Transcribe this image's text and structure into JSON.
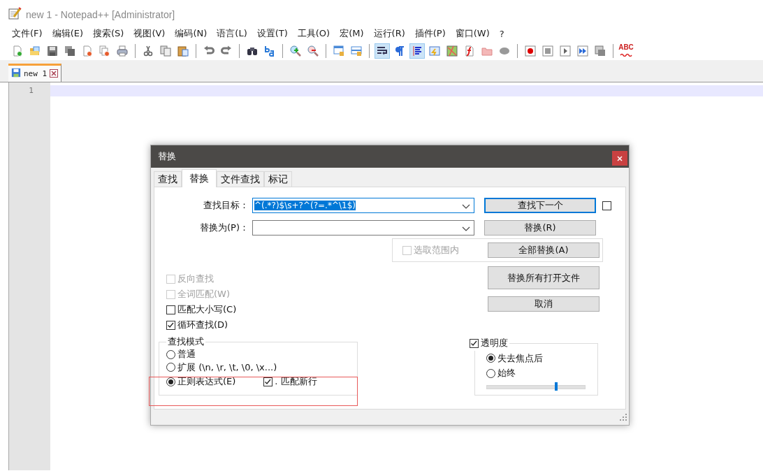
{
  "window": {
    "title": "new 1 - Notepad++ [Administrator]"
  },
  "menu": [
    "文件(F)",
    "编辑(E)",
    "搜索(S)",
    "视图(V)",
    "编码(N)",
    "语言(L)",
    "设置(T)",
    "工具(O)",
    "宏(M)",
    "运行(R)",
    "插件(P)",
    "窗口(W)",
    "?"
  ],
  "toolbar": [
    {
      "kind": "new",
      "on": false
    },
    {
      "kind": "open",
      "on": false
    },
    {
      "kind": "save",
      "on": false
    },
    {
      "kind": "saveall",
      "on": false
    },
    {
      "kind": "close",
      "on": false
    },
    {
      "kind": "closeall",
      "on": false
    },
    {
      "kind": "print",
      "on": false
    },
    {
      "kind": "separator"
    },
    {
      "kind": "cut",
      "on": false
    },
    {
      "kind": "copy",
      "on": false
    },
    {
      "kind": "paste",
      "on": false
    },
    {
      "kind": "separator"
    },
    {
      "kind": "undo",
      "on": false
    },
    {
      "kind": "redo",
      "on": false
    },
    {
      "kind": "separator"
    },
    {
      "kind": "find",
      "on": false
    },
    {
      "kind": "replace",
      "on": false
    },
    {
      "kind": "separator"
    },
    {
      "kind": "zoomin",
      "on": false
    },
    {
      "kind": "zoomout",
      "on": false
    },
    {
      "kind": "separator"
    },
    {
      "kind": "syncv",
      "on": false
    },
    {
      "kind": "synch",
      "on": false
    },
    {
      "kind": "separator"
    },
    {
      "kind": "wrap",
      "on": true
    },
    {
      "kind": "pilcrow",
      "on": false
    },
    {
      "kind": "indent",
      "on": true
    },
    {
      "kind": "lang",
      "on": false
    },
    {
      "kind": "map",
      "on": false
    },
    {
      "kind": "func",
      "on": false
    },
    {
      "kind": "folder",
      "on": false
    },
    {
      "kind": "oval",
      "on": false
    },
    {
      "kind": "separator"
    },
    {
      "kind": "record",
      "on": false
    },
    {
      "kind": "stop",
      "on": false
    },
    {
      "kind": "play",
      "on": false
    },
    {
      "kind": "ff",
      "on": false
    },
    {
      "kind": "macrosave",
      "on": false
    },
    {
      "kind": "separator"
    },
    {
      "kind": "spellcheck",
      "on": false,
      "label": "ABC"
    }
  ],
  "tabs": [
    {
      "label": "new 1",
      "selected": true
    }
  ],
  "editor": {
    "line_numbers": [
      "1"
    ]
  },
  "dialog": {
    "title": "替换",
    "tabs": [
      {
        "label": "查找",
        "selected": false
      },
      {
        "label": "替换",
        "selected": true
      },
      {
        "label": "文件查找",
        "selected": false
      },
      {
        "label": "标记",
        "selected": false
      }
    ],
    "find_field": {
      "label": "查找目标：",
      "value": "^(.*?)$\\s+?^(?=.*^\\1$)",
      "text_selected": true
    },
    "replace_field": {
      "label": "替换为(P)："
    },
    "buttons": [
      {
        "label": "查找下一个",
        "focused": true
      },
      {
        "label": "替换(R)",
        "focused": false
      },
      {
        "label": "全部替换(A)",
        "focused": false
      },
      {
        "label": "替换所有打开文件",
        "focused": false
      },
      {
        "label": "取消",
        "focused": false
      }
    ],
    "pin_checkbox": {
      "checked": false
    },
    "in_selection": {
      "label": "选取范围内",
      "checked": false,
      "disabled": true
    },
    "options": [
      {
        "label": "反向查找",
        "checked": false,
        "disabled": true
      },
      {
        "label": "全词匹配(W)",
        "checked": false,
        "disabled": true
      },
      {
        "label": "匹配大小写(C)",
        "checked": false,
        "disabled": false
      },
      {
        "label": "循环查找(D)",
        "checked": true,
        "disabled": false
      }
    ],
    "search_mode": {
      "title": "查找模式",
      "modes": [
        {
          "label": "普通",
          "selected": false
        },
        {
          "label": "扩展 (\\n, \\r, \\t, \\0, \\x...)",
          "selected": false
        },
        {
          "label": "正则表达式(E)",
          "selected": true
        }
      ],
      "dot_newline": {
        "label": ". 匹配新行",
        "checked": true
      }
    },
    "transparency": {
      "label": "透明度",
      "checked": true,
      "modes": [
        {
          "label": "失去焦点后",
          "selected": true
        },
        {
          "label": "始终",
          "selected": false
        }
      ],
      "level": 0.71
    }
  }
}
